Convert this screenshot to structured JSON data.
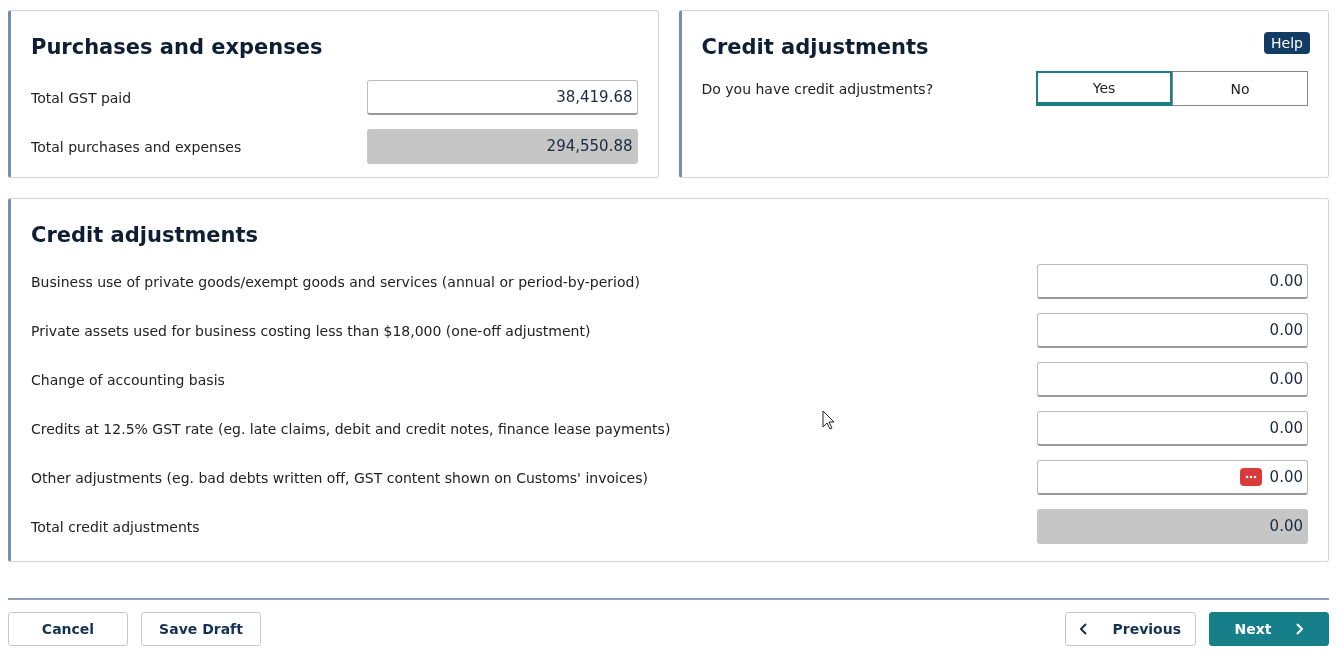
{
  "purchases": {
    "title": "Purchases and expenses",
    "rows": [
      {
        "label": "Total GST paid",
        "value": "38,419.68",
        "disabled": false
      },
      {
        "label": "Total purchases and expenses",
        "value": "294,550.88",
        "disabled": true
      }
    ]
  },
  "credit_question": {
    "title": "Credit adjustments",
    "help": "Help",
    "question": "Do you have credit adjustments?",
    "options": [
      {
        "label": "Yes",
        "selected": true
      },
      {
        "label": "No",
        "selected": false
      }
    ]
  },
  "credit_adjustments": {
    "title": "Credit adjustments",
    "rows": [
      {
        "label": "Business use of private goods/exempt goods and services (annual or period-by-period)",
        "value": "0.00",
        "disabled": false,
        "badge": false
      },
      {
        "label": "Private assets used for business costing less than $18,000 (one-off adjustment)",
        "value": "0.00",
        "disabled": false,
        "badge": false
      },
      {
        "label": "Change of accounting basis",
        "value": "0.00",
        "disabled": false,
        "badge": false
      },
      {
        "label": "Credits at 12.5% GST rate (eg. late claims, debit and credit notes, finance lease payments)",
        "value": "0.00",
        "disabled": false,
        "badge": false
      },
      {
        "label": "Other adjustments (eg. bad debts written off, GST content shown on Customs' invoices)",
        "value": "0.00",
        "disabled": false,
        "badge": true
      },
      {
        "label": "Total credit adjustments",
        "value": "0.00",
        "disabled": true,
        "badge": false
      }
    ]
  },
  "footer": {
    "left_buttons": [
      "Cancel",
      "Save Draft"
    ],
    "previous": "Previous",
    "next": "Next"
  }
}
